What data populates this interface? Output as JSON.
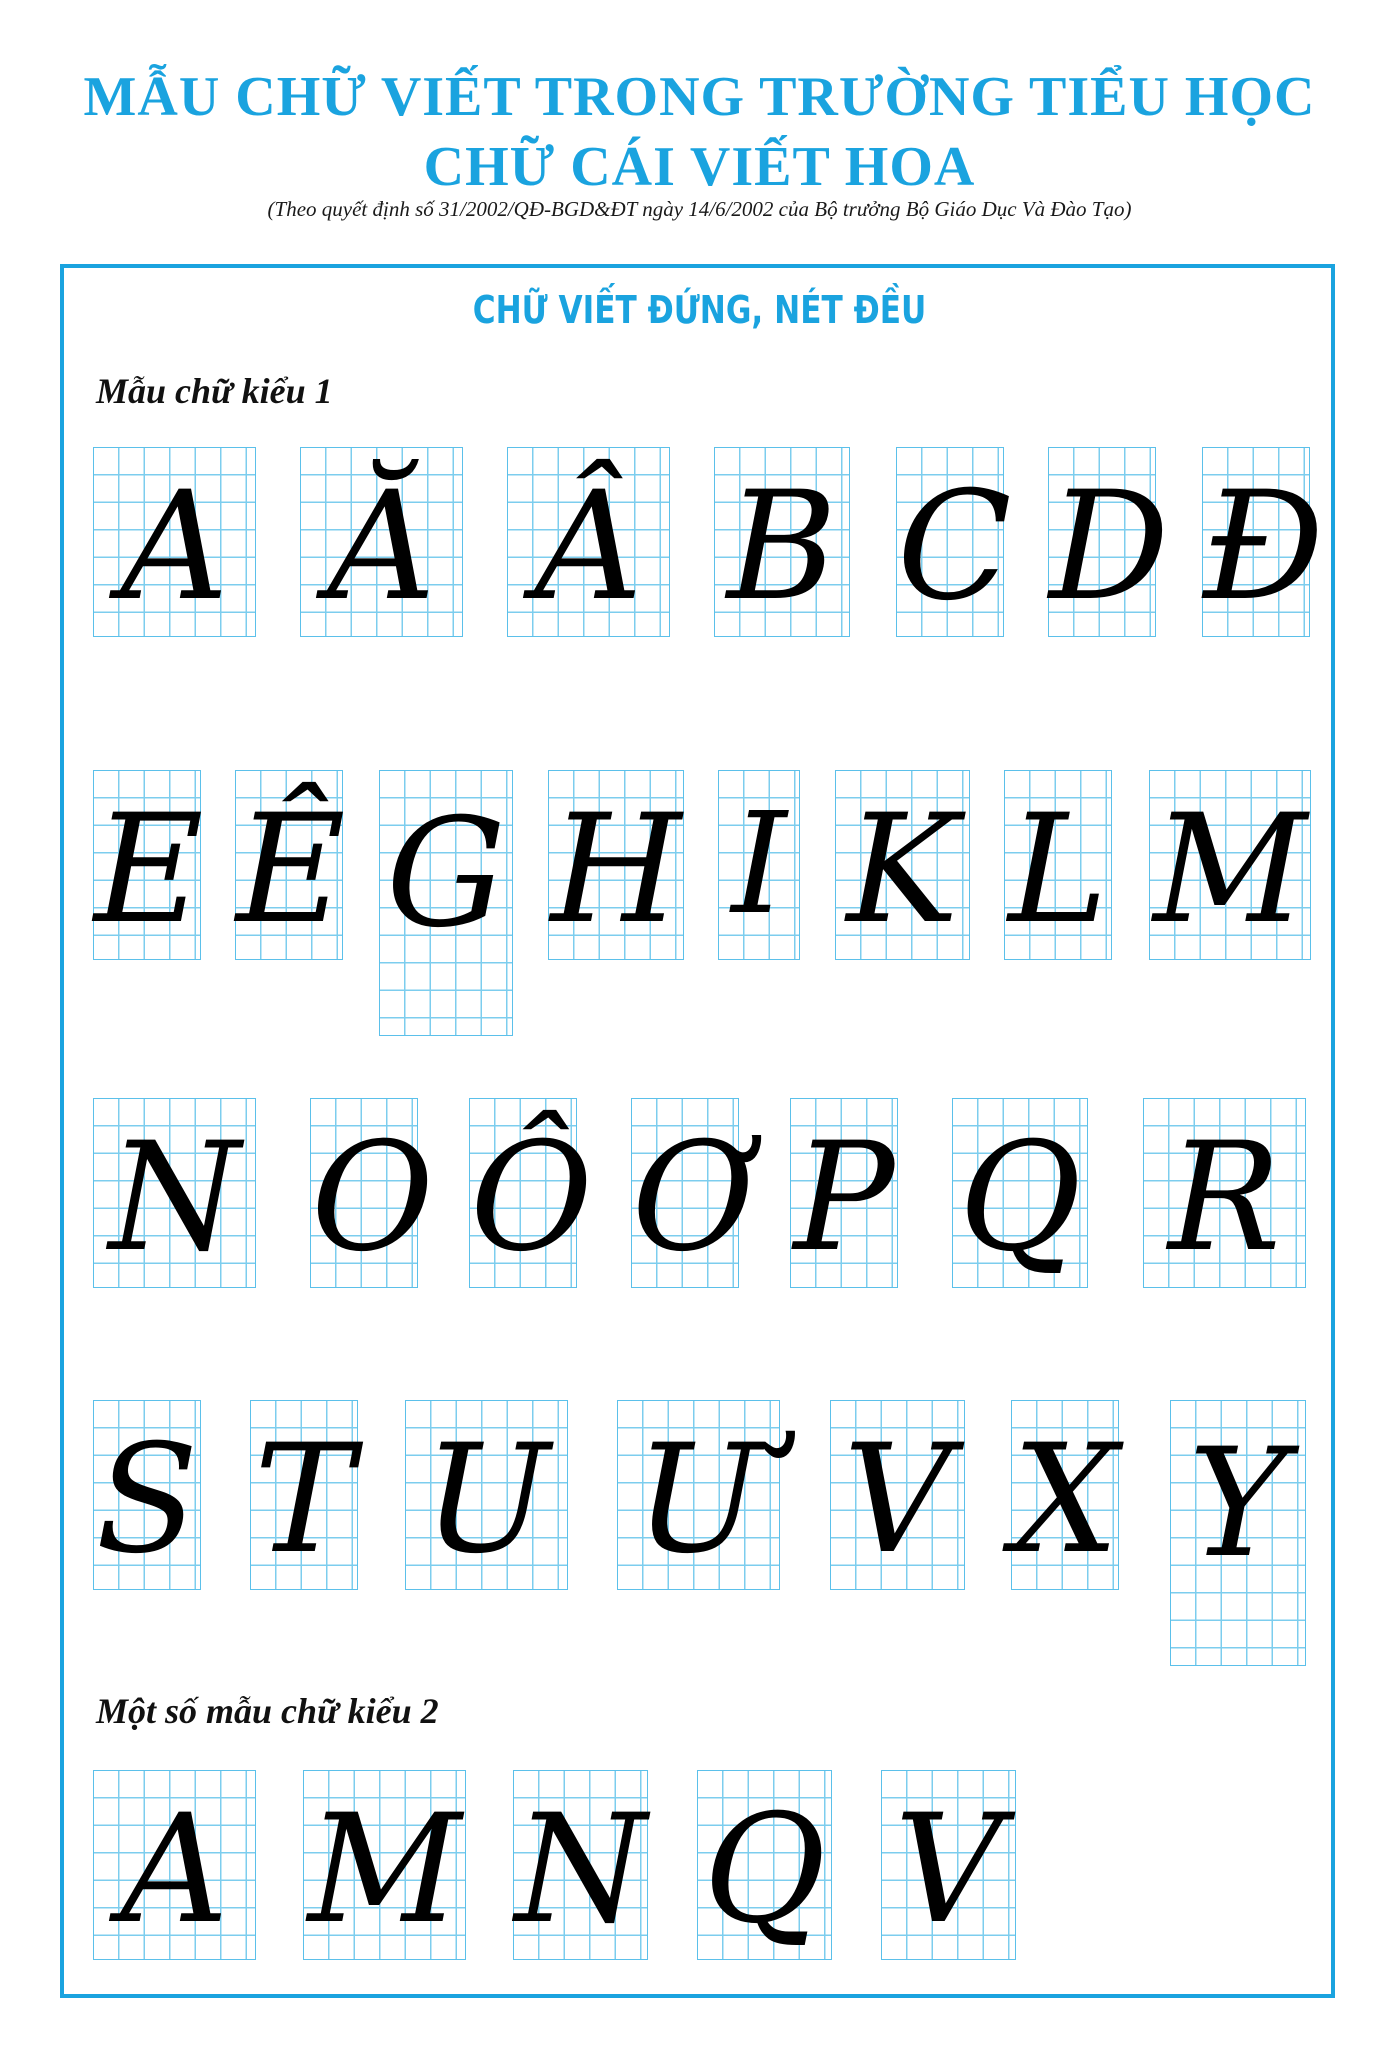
{
  "header": {
    "title_line1": "MẪU CHỮ VIẾT TRONG TRƯỜNG TIỂU HỌC",
    "title_line2": "CHỮ CÁI VIẾT HOA",
    "subtitle": "(Theo quyết định số 31/2002/QĐ-BGD&ĐT ngày 14/6/2002 của Bộ trưởng Bộ Giáo Dục Và Đào Tạo)"
  },
  "section": {
    "heading": "CHỮ VIẾT ĐỨNG, NÉT ĐỀU",
    "style1_label": "Mẫu chữ kiểu 1",
    "style2_label": "Một số mẫu chữ kiểu 2"
  },
  "style1_letters": [
    "A",
    "Ă",
    "Â",
    "B",
    "C",
    "D",
    "Đ",
    "E",
    "Ê",
    "G",
    "H",
    "I",
    "K",
    "L",
    "M",
    "N",
    "O",
    "Ô",
    "Ơ",
    "P",
    "Q",
    "R",
    "S",
    "T",
    "U",
    "Ư",
    "V",
    "X",
    "Y"
  ],
  "style2_letters": [
    "A",
    "M",
    "N",
    "Q",
    "V"
  ],
  "colors": {
    "accent": "#1AA3DF",
    "grid": "#7CCDEE",
    "ink": "#000000"
  }
}
